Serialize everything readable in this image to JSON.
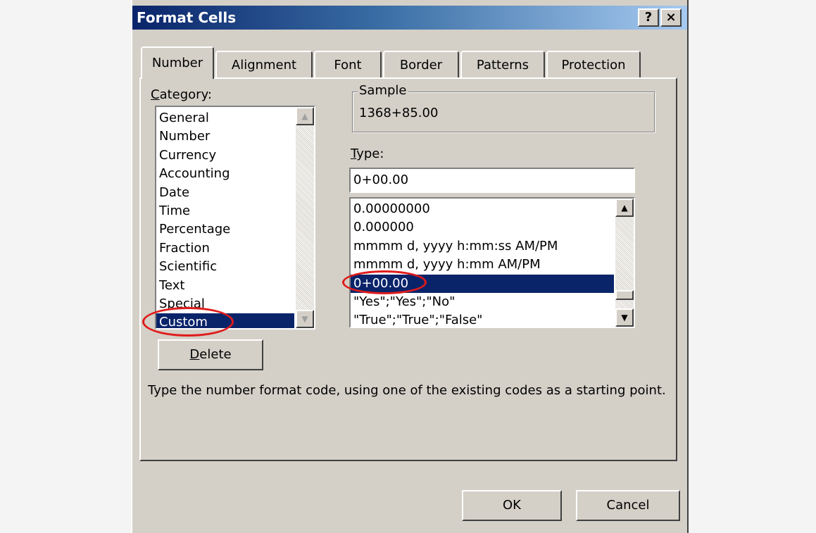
{
  "dialog": {
    "title": "Format Cells",
    "help_button": "?",
    "close_button": "×"
  },
  "tabs": [
    {
      "label": "Number",
      "active": true
    },
    {
      "label": "Alignment",
      "active": false
    },
    {
      "label": "Font",
      "active": false
    },
    {
      "label": "Border",
      "active": false
    },
    {
      "label": "Patterns",
      "active": false
    },
    {
      "label": "Protection",
      "active": false
    }
  ],
  "category": {
    "label": "Category:",
    "items": [
      "General",
      "Number",
      "Currency",
      "Accounting",
      "Date",
      "Time",
      "Percentage",
      "Fraction",
      "Scientific",
      "Text",
      "Special",
      "Custom"
    ],
    "selected": "Custom"
  },
  "sample": {
    "label": "Sample",
    "value": "1368+85.00"
  },
  "type": {
    "label": "Type:",
    "value": "0+00.00",
    "items": [
      "0.00000000",
      "0.000000",
      "mmmm d, yyyy  h:mm:ss AM/PM",
      "mmmm d, yyyy  h:mm AM/PM",
      "0+00.00",
      "\"Yes\";\"Yes\";\"No\"",
      "\"True\";\"True\";\"False\""
    ],
    "selected": "0+00.00"
  },
  "delete_button": "Delete",
  "description": "Type the number format code, using one of the existing codes as a starting point.",
  "ok_button": "OK",
  "cancel_button": "Cancel",
  "icons": {
    "scroll_up": "▲",
    "scroll_down": "▼"
  },
  "colors": {
    "dialog_face": "#d4d0c8",
    "titlebar_dark": "#0a246a",
    "selection": "#0a246a",
    "annotation_circle": "#e01b1b"
  }
}
